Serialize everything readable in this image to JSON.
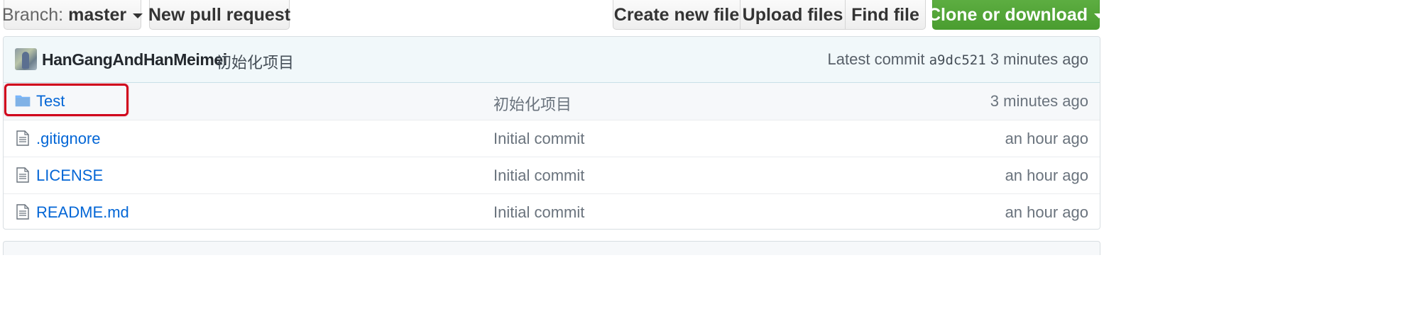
{
  "toolbar": {
    "branch_prefix": "Branch:",
    "branch_name": "master",
    "new_pull_request": "New pull request",
    "create_new_file": "Create new file",
    "upload_files": "Upload files",
    "find_file": "Find file",
    "clone_or_download": "Clone or download"
  },
  "commit": {
    "author": "HanGangAndHanMeimei",
    "message": "初始化项目",
    "latest_label": "Latest commit",
    "sha": "a9dc521",
    "age": "3 minutes ago"
  },
  "files": [
    {
      "name": "Test",
      "type": "folder",
      "message": "初始化项目",
      "age": "3 minutes ago",
      "highlighted": true
    },
    {
      "name": ".gitignore",
      "type": "file",
      "message": "Initial commit",
      "age": "an hour ago"
    },
    {
      "name": "LICENSE",
      "type": "file",
      "message": "Initial commit",
      "age": "an hour ago"
    },
    {
      "name": "README.md",
      "type": "file",
      "message": "Initial commit",
      "age": "an hour ago"
    }
  ],
  "icons": {
    "folder": "folder-icon",
    "file": "file-text-icon",
    "branch_dropdown": "chevron-down-icon"
  },
  "colors": {
    "link": "#0366d6",
    "clone_button": "#4a9d30",
    "commit_bar": "#f1f8fa",
    "folder_icon": "#79b8ff",
    "highlight_annotation": "#d0021b"
  }
}
